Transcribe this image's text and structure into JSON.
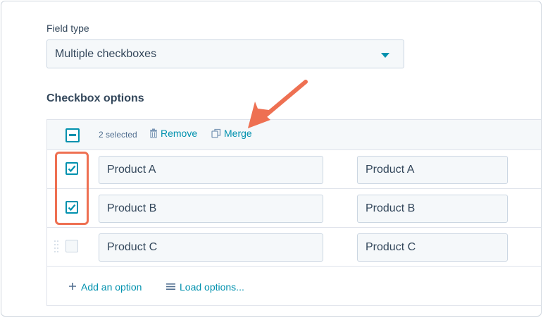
{
  "field_type": {
    "label": "Field type",
    "selected_value": "Multiple checkboxes"
  },
  "checkbox_options": {
    "title": "Checkbox options",
    "toolbar": {
      "selected_count": "2 selected",
      "remove_label": "Remove",
      "merge_label": "Merge"
    },
    "rows": [
      {
        "label": "Product A",
        "value": "Product A",
        "checked": true
      },
      {
        "label": "Product B",
        "value": "Product B",
        "checked": true
      },
      {
        "label": "Product C",
        "value": "Product C",
        "checked": false
      }
    ],
    "footer": {
      "add_option": "Add an option",
      "load_options": "Load options..."
    }
  },
  "colors": {
    "accent": "#0091ae",
    "annotation": "#ee7052",
    "text": "#33475b",
    "input_bg": "#f5f8fa"
  },
  "icons": [
    "chevron-down-icon",
    "minus-checkbox-icon",
    "trash-icon",
    "merge-icon",
    "checkmark-icon",
    "drag-handle-icon",
    "plus-icon",
    "list-icon"
  ]
}
